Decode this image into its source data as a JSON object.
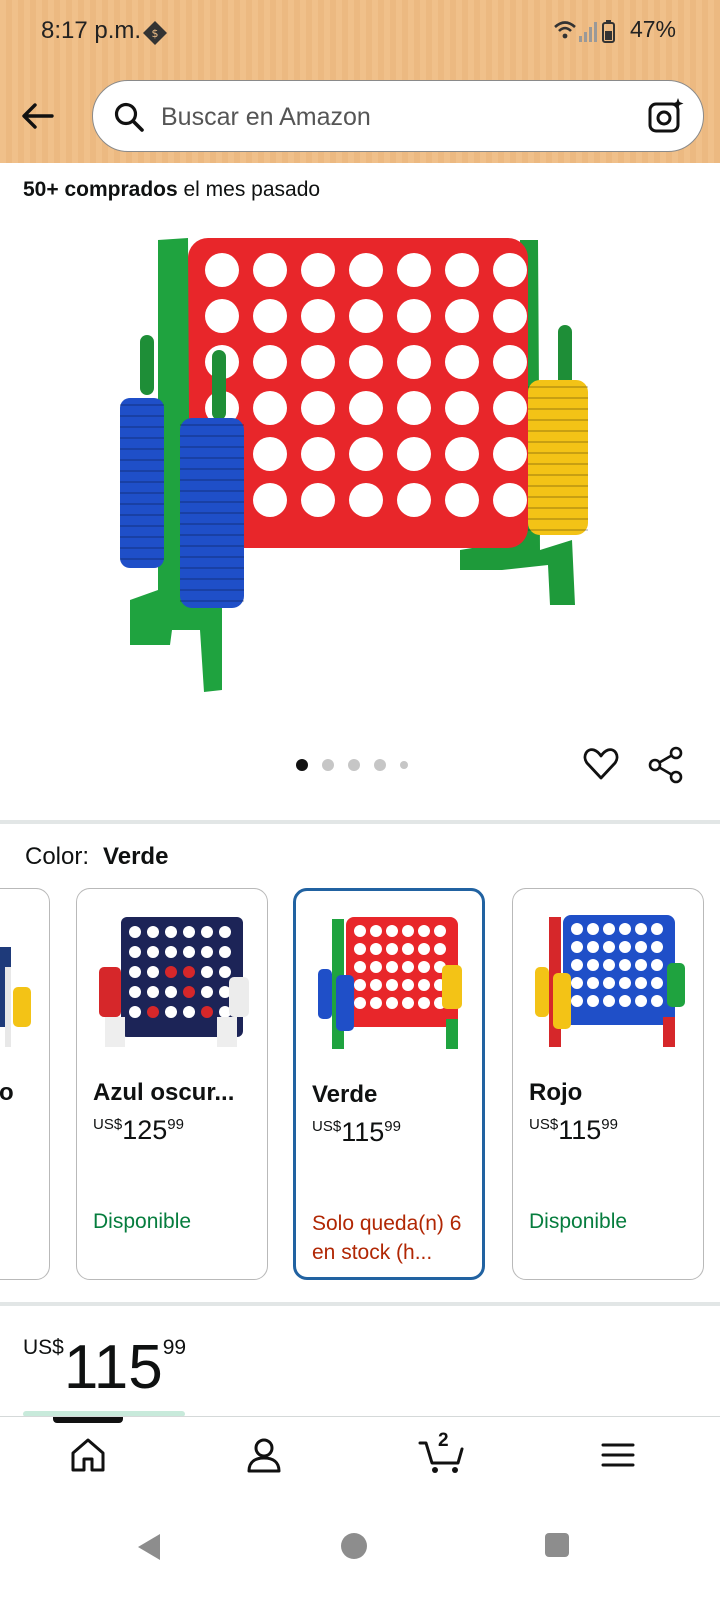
{
  "status_bar": {
    "time": "8:17 p.m.",
    "battery": "47%",
    "icons": [
      "tag-badge-icon",
      "wifi-icon",
      "signal-icon",
      "battery-icon"
    ]
  },
  "search": {
    "placeholder": "Buscar en Amazon"
  },
  "product": {
    "bought_strong": "50+ comprados",
    "bought_rest": " el mes pasado",
    "image_dots_total": 5,
    "image_dots_active": 1
  },
  "color_selector": {
    "label": "Color:",
    "selected": "Verde",
    "options": [
      {
        "name": "o",
        "price_currency": "",
        "price_whole": "",
        "price_cents": "",
        "availability": ""
      },
      {
        "name": "Azul oscur...",
        "price_currency": "US$",
        "price_whole": "125",
        "price_cents": "99",
        "availability": "Disponible"
      },
      {
        "name": "Verde",
        "price_currency": "US$",
        "price_whole": "115",
        "price_cents": "99",
        "availability": "Solo queda(n) 6 en stock (h..."
      },
      {
        "name": "Rojo",
        "price_currency": "US$",
        "price_whole": "115",
        "price_cents": "99",
        "availability": "Disponible"
      }
    ]
  },
  "price": {
    "currency": "US$",
    "whole": "115",
    "cents": "99"
  },
  "bottom_nav": {
    "items": [
      "home-icon",
      "account-icon",
      "cart-icon",
      "menu-icon"
    ],
    "cart_count": "2"
  },
  "colors": {
    "header_bg": "#f0c08a",
    "in_stock": "#067d3e",
    "low_stock": "#b12704",
    "selected_border": "#2162a1"
  }
}
